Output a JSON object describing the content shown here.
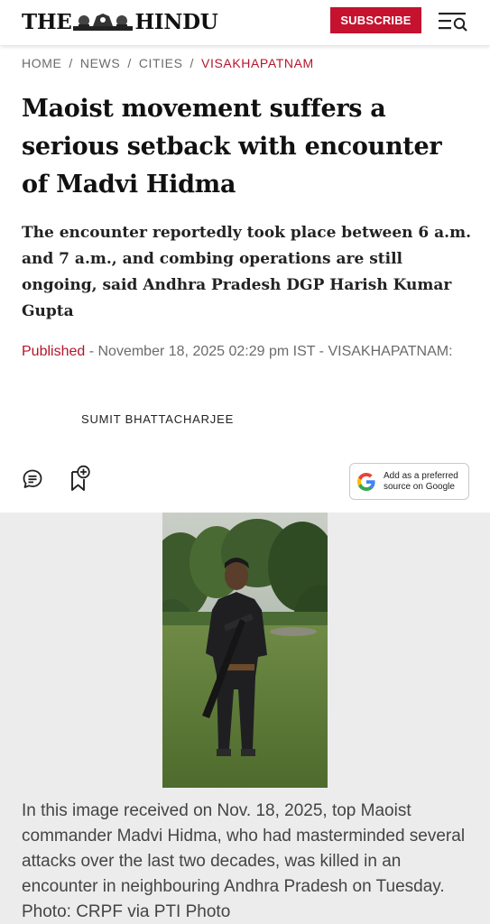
{
  "header": {
    "logo_left": "THE",
    "logo_right": "HINDU",
    "subscribe_label": "SUBSCRIBE",
    "menu_icon": "menu-search-icon",
    "brand_color": "#c4122f"
  },
  "breadcrumb": {
    "items": [
      "HOME",
      "NEWS",
      "CITIES",
      "VISAKHAPATNAM"
    ],
    "separator": "/"
  },
  "article": {
    "headline": "Maoist movement suffers a serious setback with encounter of Madvi Hidma",
    "summary": "The encounter reportedly took place between 6 a.m. and 7 a.m., and combing operations are still ongoing, said Andhra Pradesh DGP Harish Kumar Gupta",
    "published_label": "Published",
    "published_rest": " - November 18, 2025 02:29 pm IST - VISAKHAPATNAM:",
    "author": "SUMIT BHATTACHARJEE"
  },
  "actions": {
    "comment_icon": "comment-icon",
    "bookmark_icon": "bookmark-add-icon",
    "google_pref_label": "Add as a preferred source on Google",
    "google_pref_line1": "Add as a preferred",
    "google_pref_line2": "source on Google"
  },
  "media": {
    "caption": "In this image received on Nov. 18, 2025, top Maoist commander Madvi Hidma, who had masterminded several attacks over the last two decades, was killed in an encounter in neighbouring Andhra Pradesh on Tuesday. Photo: CRPF via PTI Photo"
  }
}
